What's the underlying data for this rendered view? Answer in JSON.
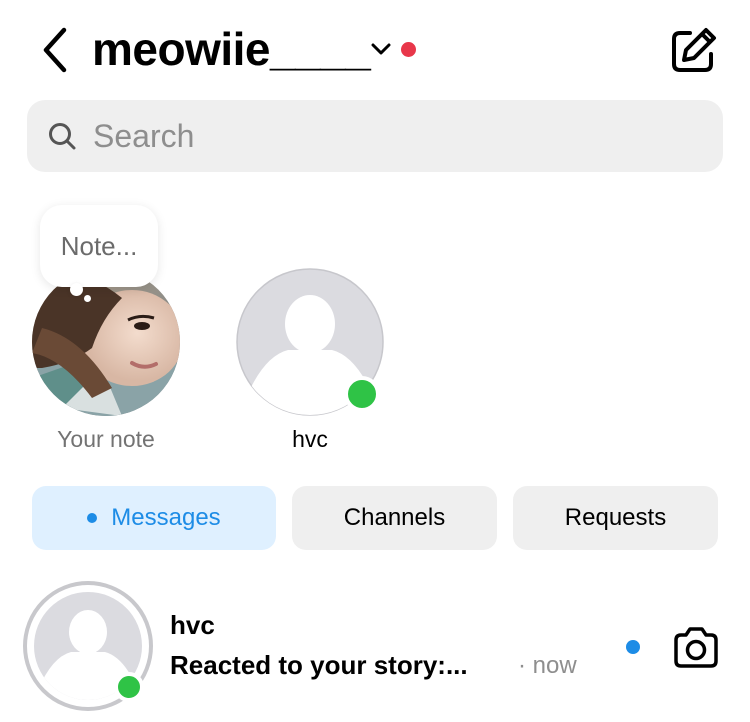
{
  "header": {
    "back_icon": "chevron-left-icon",
    "username": "meowiie____",
    "account_switch_icon": "chevron-down-icon",
    "compose_icon": "edit-icon"
  },
  "search": {
    "placeholder": "Search",
    "icon": "search-icon"
  },
  "notes": {
    "bubble_text": "Note...",
    "own_label": "Your note",
    "friends": [
      {
        "name": "hvc",
        "online": true
      }
    ]
  },
  "tabs": [
    {
      "label": "Messages",
      "active": true
    },
    {
      "label": "Channels",
      "active": false
    },
    {
      "label": "Requests",
      "active": false
    }
  ],
  "conversations": [
    {
      "name": "hvc",
      "preview": "Reacted to your story:...",
      "time": "· now",
      "unread": true,
      "online": true,
      "action_icon": "camera-icon"
    }
  ],
  "colors": {
    "notification_dot": "#e8374a",
    "online_green": "#2fc346",
    "accent_blue": "#1d8ce6",
    "active_tab_bg": "#dff0ff",
    "chip_bg": "#efefef",
    "avatar_placeholder_bg": "#dbdbe0"
  }
}
